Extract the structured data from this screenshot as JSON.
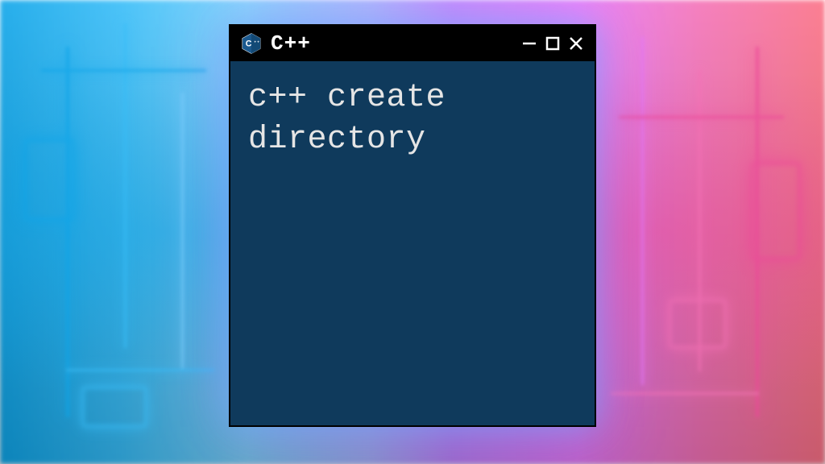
{
  "window": {
    "title": "C++",
    "icon": "cpp-logo"
  },
  "content": {
    "text": "c++ create directory"
  },
  "controls": {
    "minimize": "−",
    "maximize": "□",
    "close": "✕"
  },
  "colors": {
    "window_bg": "#0f3a5c",
    "titlebar_bg": "#000000",
    "text": "#e5e5e5"
  }
}
